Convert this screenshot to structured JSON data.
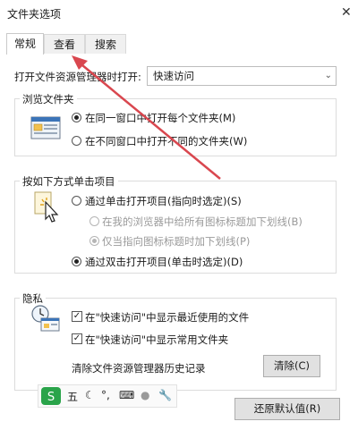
{
  "window": {
    "title": "文件夹选项",
    "close_glyph": "✕"
  },
  "tabs": [
    {
      "label": "常规",
      "active": true
    },
    {
      "label": "查看",
      "active": false
    },
    {
      "label": "搜索",
      "active": false
    }
  ],
  "open_explorer": {
    "label": "打开文件资源管理器时打开:",
    "value": "快速访问"
  },
  "browse_folders": {
    "title": "浏览文件夹",
    "options": [
      {
        "label": "在同一窗口中打开每个文件夹(M)",
        "selected": true
      },
      {
        "label": "在不同窗口中打开不同的文件夹(W)",
        "selected": false
      }
    ]
  },
  "click_items": {
    "title": "按如下方式单击项目",
    "single_click": {
      "label": "通过单击打开项目(指向时选定)(S)",
      "selected": false
    },
    "underline_browser": {
      "label": "在我的浏览器中给所有图标标题加下划线(B)",
      "selected": false,
      "disabled": true
    },
    "underline_point": {
      "label": "仅当指向图标标题时加下划线(P)",
      "selected": true,
      "disabled": true
    },
    "double_click": {
      "label": "通过双击打开项目(单击时选定)(D)",
      "selected": true
    }
  },
  "privacy": {
    "title": "隐私",
    "show_recent_files": {
      "label": "在\"快速访问\"中显示最近使用的文件",
      "checked": true
    },
    "show_frequent_folders": {
      "label": "在\"快速访问\"中显示常用文件夹",
      "checked": true
    },
    "clear_history_label": "清除文件资源管理器历史记录",
    "clear_button": "清除(C)"
  },
  "restore_button": "还原默认值(R)",
  "ime_toolbar": {
    "mode_char": "五"
  },
  "colors": {
    "annotation_arrow": "#d9474f",
    "ime_logo": "#2aa44a"
  }
}
